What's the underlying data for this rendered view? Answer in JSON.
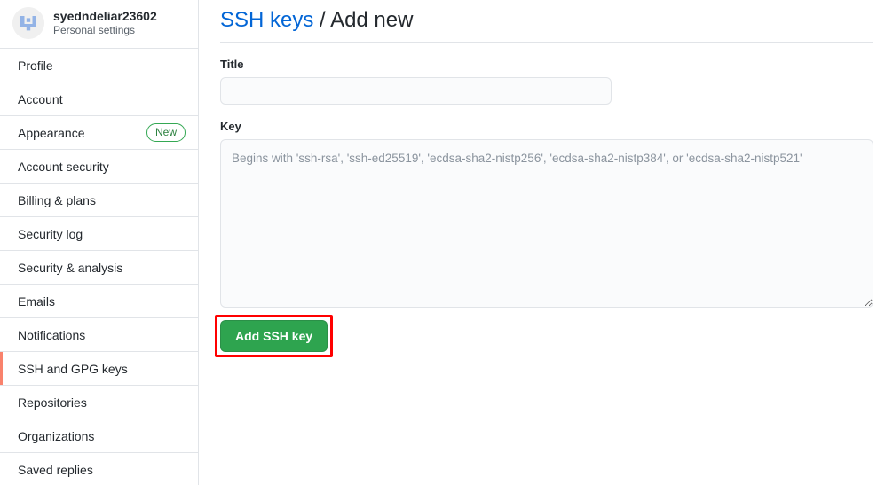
{
  "account": {
    "avatar_icon": "user-identicon-avatar",
    "username": "syedndeliar23602",
    "subtitle": "Personal settings"
  },
  "sidebar": {
    "items": [
      {
        "label": "Profile",
        "badge": null,
        "selected": false
      },
      {
        "label": "Account",
        "badge": null,
        "selected": false
      },
      {
        "label": "Appearance",
        "badge": "New",
        "selected": false
      },
      {
        "label": "Account security",
        "badge": null,
        "selected": false
      },
      {
        "label": "Billing & plans",
        "badge": null,
        "selected": false
      },
      {
        "label": "Security log",
        "badge": null,
        "selected": false
      },
      {
        "label": "Security & analysis",
        "badge": null,
        "selected": false
      },
      {
        "label": "Emails",
        "badge": null,
        "selected": false
      },
      {
        "label": "Notifications",
        "badge": null,
        "selected": false
      },
      {
        "label": "SSH and GPG keys",
        "badge": null,
        "selected": true
      },
      {
        "label": "Repositories",
        "badge": null,
        "selected": false
      },
      {
        "label": "Organizations",
        "badge": null,
        "selected": false
      },
      {
        "label": "Saved replies",
        "badge": null,
        "selected": false
      }
    ]
  },
  "header": {
    "breadcrumb_link": "SSH keys",
    "breadcrumb_separator": "/",
    "breadcrumb_current": "Add new"
  },
  "form": {
    "title_label": "Title",
    "title_value": "",
    "title_placeholder": "",
    "key_label": "Key",
    "key_value": "",
    "key_placeholder": "Begins with 'ssh-rsa', 'ssh-ed25519', 'ecdsa-sha2-nistp256', 'ecdsa-sha2-nistp384', or 'ecdsa-sha2-nistp521'",
    "submit_label": "Add SSH key"
  },
  "colors": {
    "accent_link": "#0366d6",
    "button_green": "#2ea44f",
    "badge_green": "#2b803e",
    "selected_marker": "#f9826c",
    "annotation_red": "#ff0000",
    "border": "#e1e4e8",
    "input_bg": "#fafbfc"
  }
}
